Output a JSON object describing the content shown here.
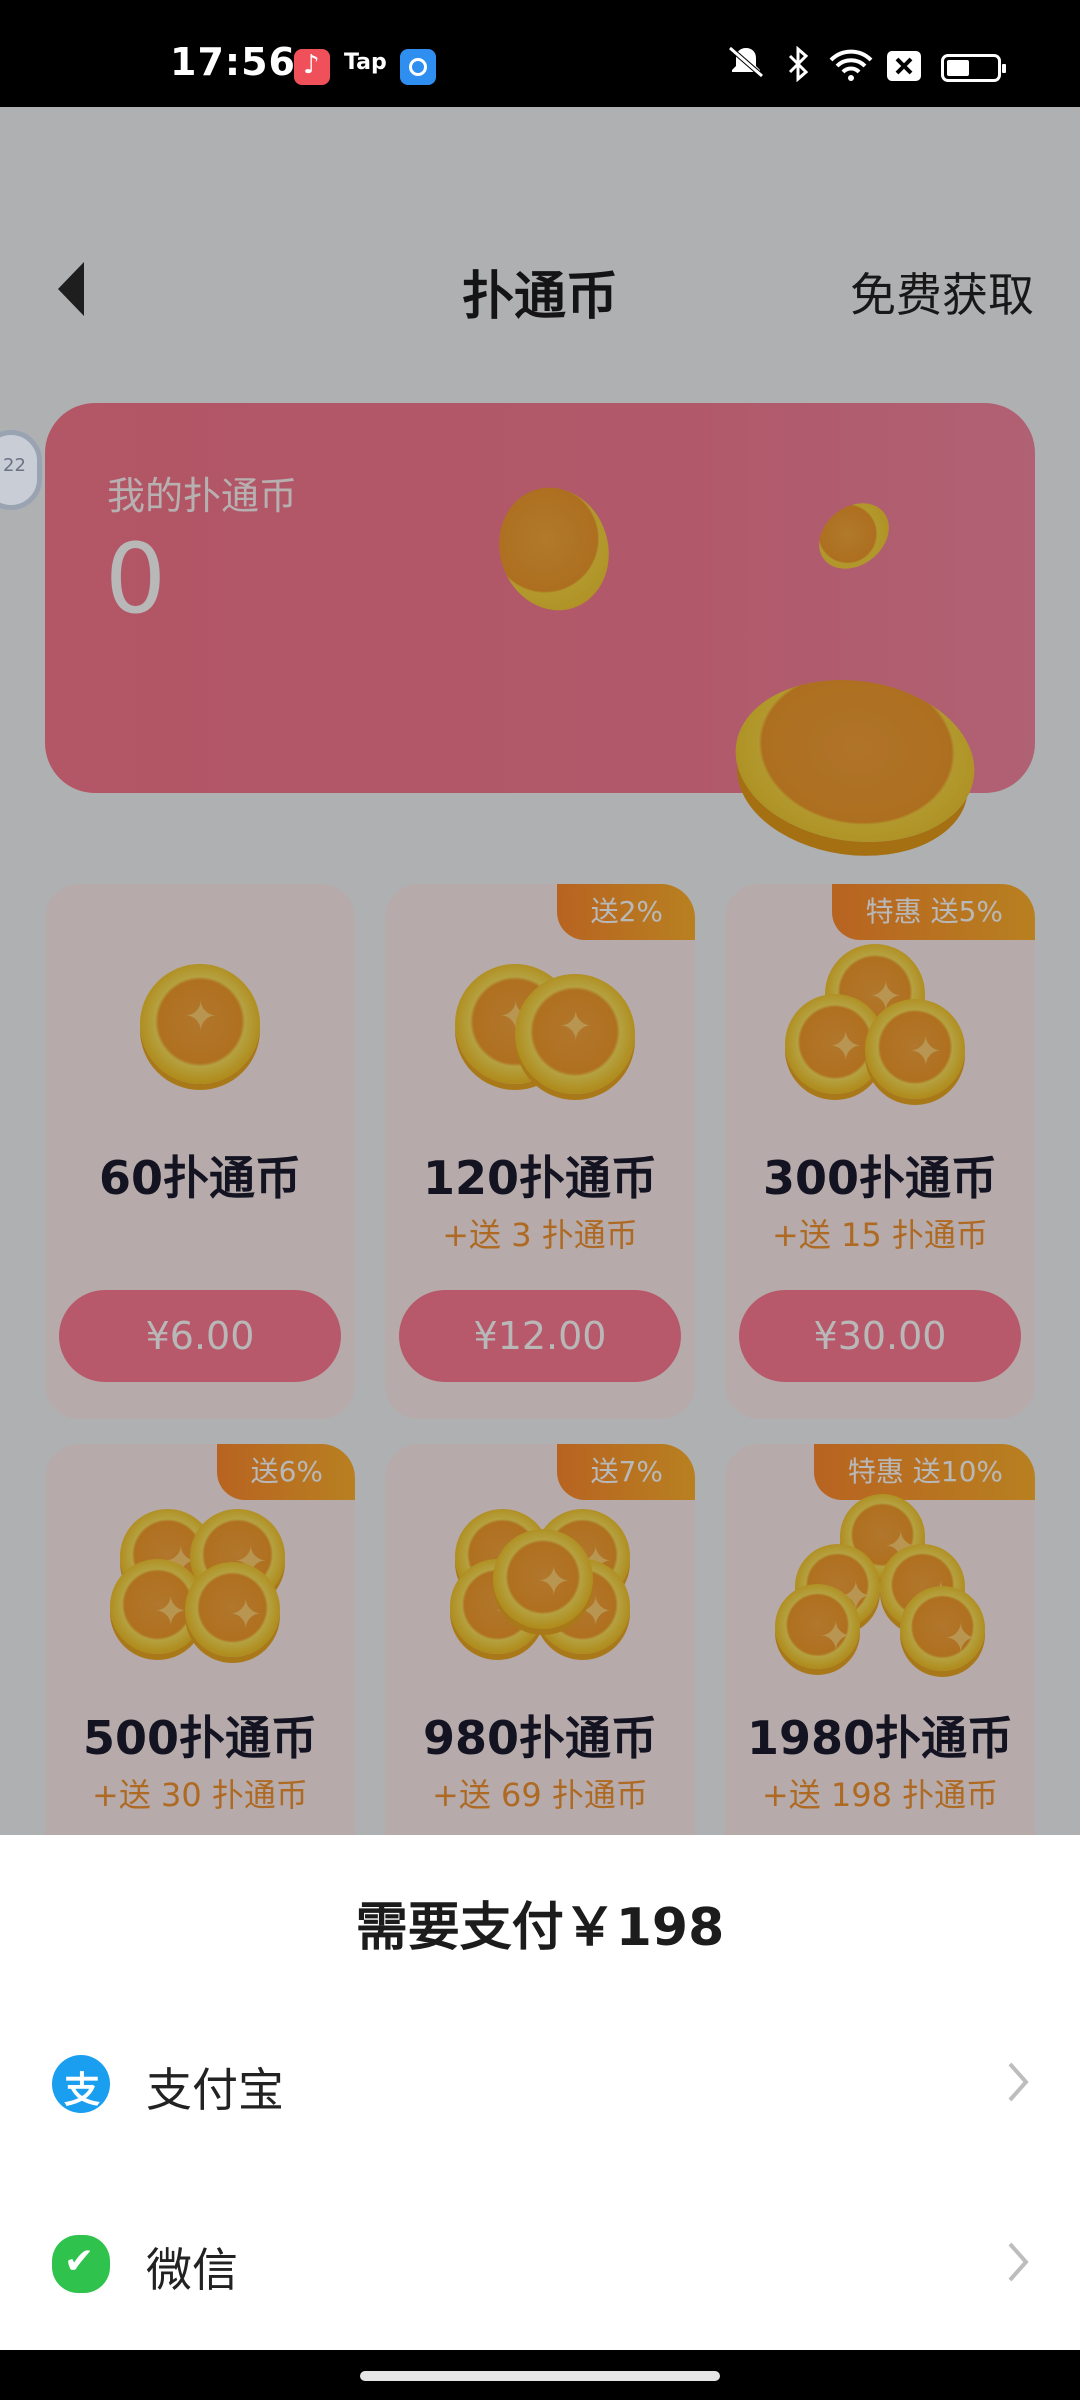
{
  "status_bar": {
    "time": "17:56",
    "apps": [
      "music-app",
      "Tap",
      "browser-app"
    ],
    "tap_label": "Tap",
    "icons": [
      "mute-icon",
      "bluetooth-icon",
      "wifi-icon",
      "sim-off-icon",
      "battery-icon"
    ]
  },
  "header": {
    "back_icon": "chevron-left-icon",
    "title": "扑通币",
    "free_link": "免费获取"
  },
  "balance": {
    "label": "我的扑通币",
    "value": "0"
  },
  "packages": [
    {
      "name": "60扑通币",
      "bonus": "",
      "badge": "",
      "price": "¥6.00"
    },
    {
      "name": "120扑通币",
      "bonus": "+送 3 扑通币",
      "badge": "送2%",
      "price": "¥12.00"
    },
    {
      "name": "300扑通币",
      "bonus": "+送 15 扑通币",
      "badge": "特惠 送5%",
      "price": "¥30.00"
    },
    {
      "name": "500扑通币",
      "bonus": "+送 30 扑通币",
      "badge": "送6%",
      "price": ""
    },
    {
      "name": "980扑通币",
      "bonus": "+送 69 扑通币",
      "badge": "送7%",
      "price": ""
    },
    {
      "name": "1980扑通币",
      "bonus": "+送 198 扑通币",
      "badge": "特惠 送10%",
      "price": ""
    }
  ],
  "payment_sheet": {
    "title": "需要支付￥198",
    "options": [
      {
        "label": "支付宝",
        "icon": "alipay-icon"
      },
      {
        "label": "微信",
        "icon": "wechat-icon"
      }
    ]
  },
  "colors": {
    "card_pink": "#f8788d",
    "price_button": "#ff7b95",
    "badge_orange": "#ff8a2e",
    "bonus_text": "#f29331",
    "alipay_blue": "#1a9ff0",
    "wechat_green": "#2fc34e"
  }
}
